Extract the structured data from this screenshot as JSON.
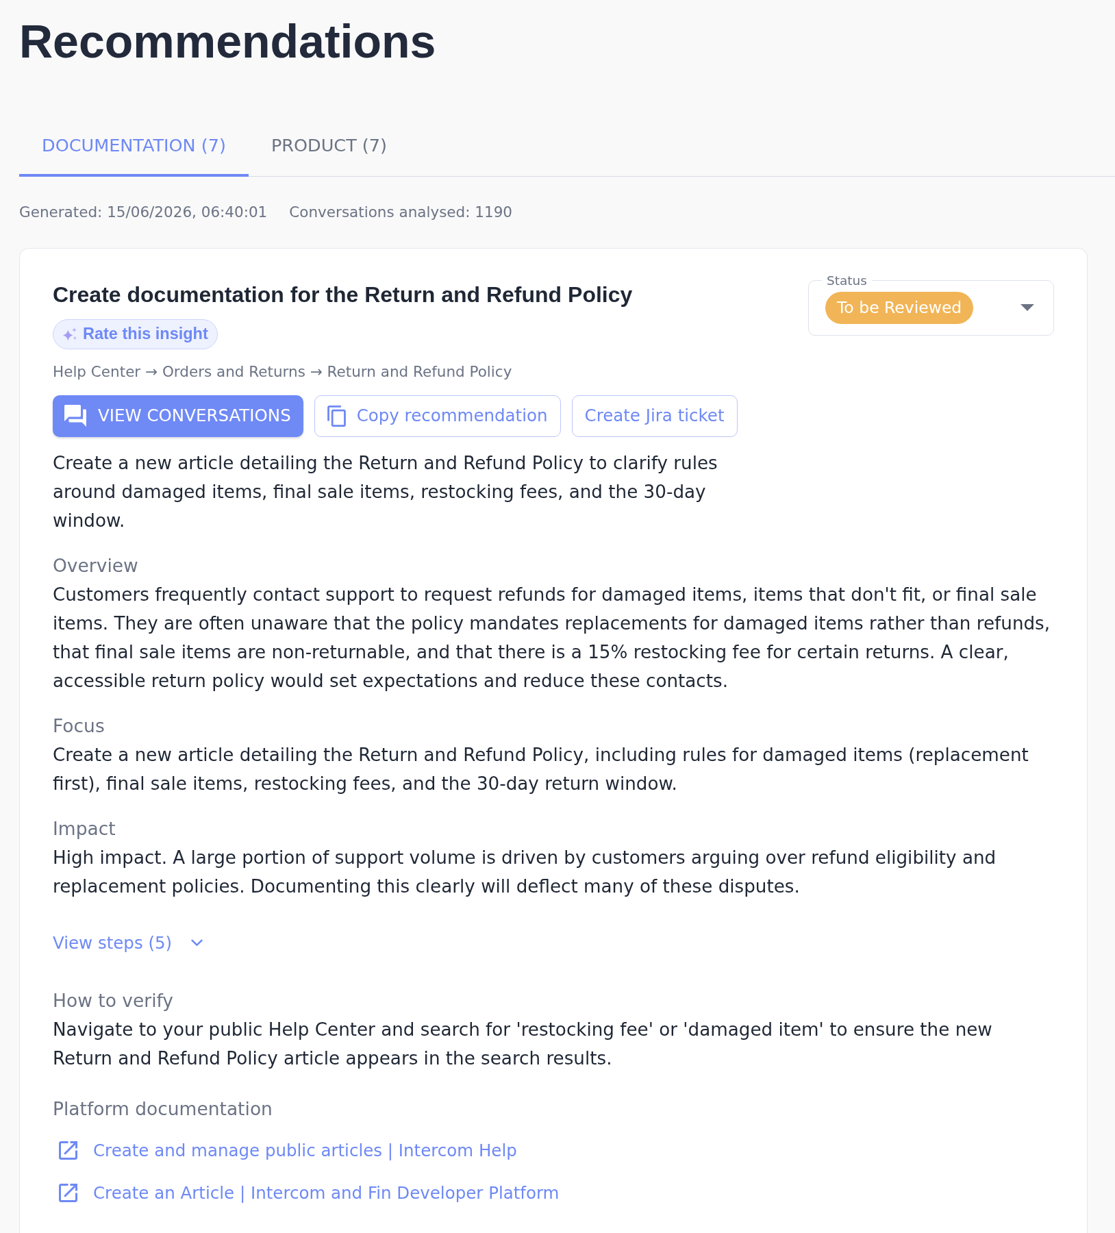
{
  "page": {
    "title": "Recommendations"
  },
  "tabs": [
    {
      "label": "DOCUMENTATION (7)",
      "selected": true
    },
    {
      "label": "PRODUCT (7)",
      "selected": false
    }
  ],
  "meta": {
    "generated": "Generated: 15/06/2026, 06:40:01",
    "conversations": "Conversations analysed: 1190"
  },
  "recommendation": {
    "title": "Create documentation for the Return and Refund Policy",
    "rate_button": "Rate this insight",
    "breadcrumb": "Help Center → Orders and Returns → Return and Refund Policy",
    "status": {
      "label": "Status",
      "value": "To be Reviewed"
    },
    "actions": [
      {
        "kind": "primary",
        "label": "VIEW CONVERSATIONS"
      },
      {
        "kind": "copy",
        "label": "Copy recommendation"
      },
      {
        "kind": "secondary",
        "label": "Create Jira ticket"
      }
    ],
    "summary": "Create a new article detailing the Return and Refund Policy to clarify rules around damaged items, final sale items, restocking fees, and the 30-day window.",
    "sections": [
      {
        "heading": "Overview",
        "text": "Customers frequently contact support to request refunds for damaged items, items that don't fit, or final sale items. They are often unaware that the policy mandates replacements for damaged items rather than refunds, that final sale items are non-returnable, and that there is a 15% restocking fee for certain returns. A clear, accessible return policy would set expectations and reduce these contacts."
      },
      {
        "heading": "Focus",
        "text": "Create a new article detailing the Return and Refund Policy, including rules for damaged items (replacement first), final sale items, restocking fees, and the 30-day return window."
      },
      {
        "heading": "Impact",
        "text": "High impact. A large portion of support volume is driven by customers arguing over refund eligibility and replacement policies. Documenting this clearly will deflect many of these disputes."
      }
    ],
    "steps_toggle": {
      "label": "View steps (5)",
      "expanded": false
    },
    "verify": {
      "heading": "How to verify",
      "text": "Navigate to your public Help Center and search for 'restocking fee' or 'damaged item' to ensure the new Return and Refund Policy article appears in the search results."
    },
    "platform_docs": {
      "heading": "Platform documentation",
      "links": [
        "Create and manage public articles | Intercom Help",
        "Create an Article | Intercom and Fin Developer Platform"
      ]
    }
  }
}
